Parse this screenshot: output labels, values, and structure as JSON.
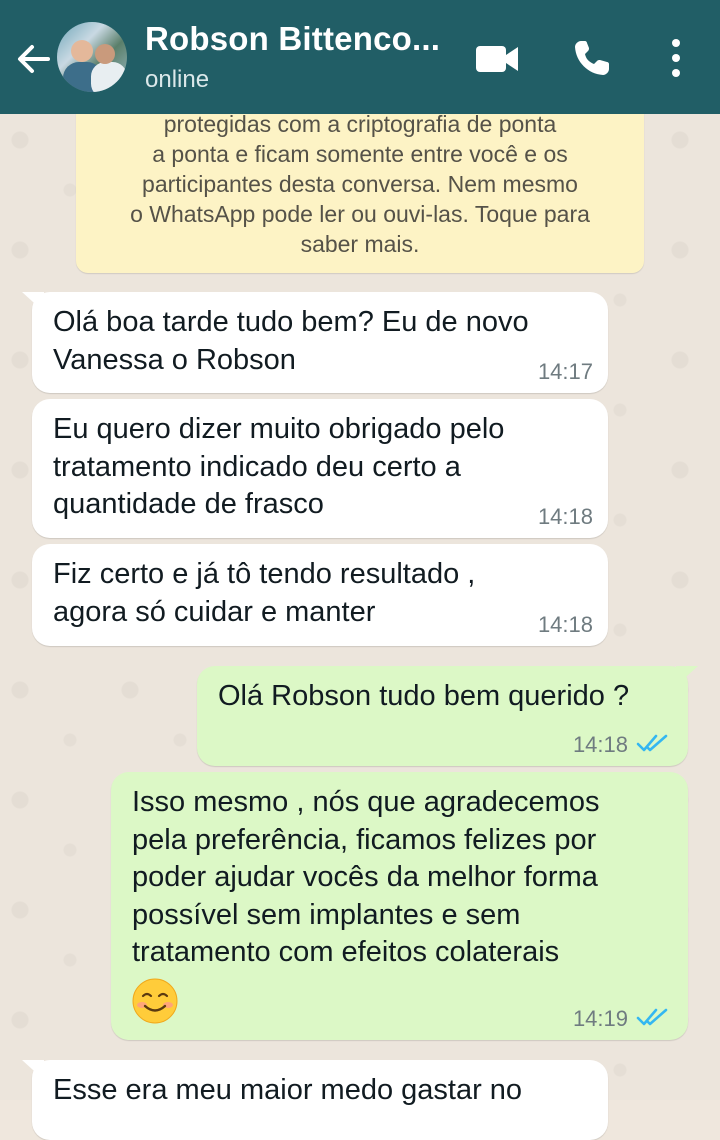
{
  "header": {
    "contact_name": "Robson Bittenco...",
    "status": "online"
  },
  "encryption_notice": {
    "lines": [
      "protegidas com a criptografia de ponta",
      "a ponta e ficam somente entre você e os",
      "participantes desta conversa. Nem mesmo",
      "o WhatsApp pode ler ou ouvi-las. Toque para",
      "saber mais."
    ]
  },
  "messages": [
    {
      "direction": "incoming",
      "lines": [
        "Olá boa tarde tudo bem? Eu de novo",
        "Vanessa o Robson"
      ],
      "time": "14:17"
    },
    {
      "direction": "incoming",
      "lines": [
        "Eu quero dizer muito obrigado pelo",
        "tratamento indicado deu certo a",
        "quantidade de frasco"
      ],
      "time": "14:18"
    },
    {
      "direction": "incoming",
      "lines": [
        "Fiz certo e já tô tendo resultado ,",
        "agora só cuidar e manter"
      ],
      "time": "14:18"
    },
    {
      "direction": "outgoing",
      "lines": [
        "Olá Robson tudo bem querido ?"
      ],
      "time": "14:18",
      "status": "read"
    },
    {
      "direction": "outgoing",
      "lines": [
        "Isso mesmo , nós que agradecemos",
        "pela preferência, ficamos felizes por",
        "poder ajudar vocês da melhor forma",
        "possível sem implantes e sem",
        "tratamento com efeitos colaterais"
      ],
      "emoji": "smiling-face-with-blush",
      "time": "14:19",
      "status": "read"
    },
    {
      "direction": "incoming",
      "lines": [
        "Esse era meu maior medo gastar no"
      ]
    }
  ],
  "colors": {
    "header_bg": "#215e66",
    "chat_bg": "#ece5dc",
    "incoming_bubble": "#ffffff",
    "outgoing_bubble": "#dcf8c6",
    "notice_bg": "#fdf3c5",
    "read_ticks": "#34b7f1"
  },
  "icons": {
    "back": "back-arrow-icon",
    "video": "video-camera-icon",
    "call": "phone-icon",
    "menu": "kebab-menu-icon",
    "ticks": "double-check-icon"
  }
}
